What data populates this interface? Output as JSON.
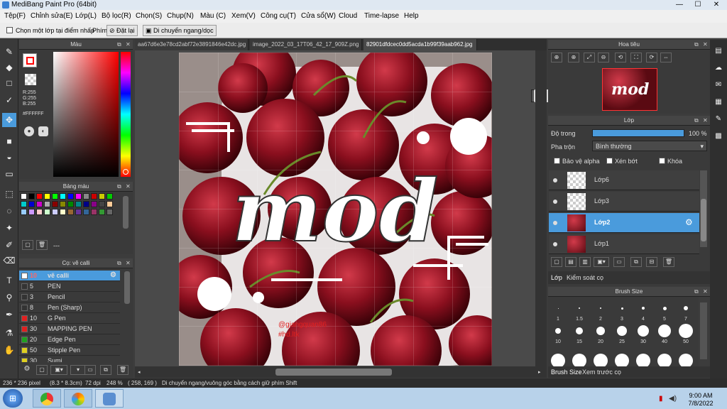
{
  "window": {
    "title": "MediBang Paint Pro (64bit)"
  },
  "menu": [
    "Tệp(F)",
    "Chỉnh sửa(E)",
    "Lớp(L)",
    "Bộ lọc(R)",
    "Chọn(S)",
    "Chụp(N)",
    "Màu (C)",
    "Xem(V)",
    "Công cụ(T)",
    "Cửa sổ(W)",
    "Cloud",
    "Time-lapse",
    "Help"
  ],
  "options": {
    "select_layer": "Chọn một lớp tại điểm nhấp",
    "phim": "Phím",
    "reset": "Đặt lại",
    "move_label": "Di chuyển ngang/dọc"
  },
  "color_panel": {
    "title": "Màu",
    "r": "R:255",
    "g": "G:255",
    "b": "B:255",
    "hex": "#FFFFFF"
  },
  "palette": {
    "title": "Bảng màu",
    "text": "---"
  },
  "brush": {
    "title": "Cọ: vẽ calli",
    "items": [
      {
        "num": "10",
        "label": "vẽ calli",
        "color": "#ffffff",
        "active": true
      },
      {
        "num": "5",
        "label": "PEN",
        "color": "#333333"
      },
      {
        "num": "3",
        "label": "Pencil",
        "color": "#333333"
      },
      {
        "num": "8",
        "label": "Pen (Sharp)",
        "color": "#333333"
      },
      {
        "num": "10",
        "label": "G Pen",
        "color": "#e02020"
      },
      {
        "num": "30",
        "label": "MAPPING PEN",
        "color": "#e02020"
      },
      {
        "num": "20",
        "label": "Edge Pen",
        "color": "#20a020"
      },
      {
        "num": "50",
        "label": "Stipple Pen",
        "color": "#e0d020"
      },
      {
        "num": "30",
        "label": "Sumi",
        "color": "#e0d020"
      }
    ]
  },
  "tabs": [
    "aa67d6e3e78cd2abf72e3891846e42dc.jpg",
    "image_2022_03_17T06_42_17_909Z.png",
    "82901dfdcec0dd5acda1b99f39aab962.jpg"
  ],
  "canvas": {
    "art_text": "mod",
    "credit1": "@giangquan86",
    "credit2": "#hd.ltk"
  },
  "navigator": {
    "title": "Hoa tiêu",
    "thumb_text": "mod"
  },
  "layers": {
    "title": "Lớp",
    "opacity_label": "Độ trong",
    "opacity_value": "100 %",
    "opacity_fraction": 1.0,
    "blend_label": "Pha trộn",
    "blend_value": "Bình thường",
    "protect_alpha": "Bảo vệ alpha",
    "clip": "Xén bớt",
    "lock": "Khóa",
    "items": [
      {
        "name": "Lớp6",
        "selected": false
      },
      {
        "name": "Lớp3",
        "selected": false
      },
      {
        "name": "Lớp2",
        "selected": true
      },
      {
        "name": "Lớp1",
        "selected": false
      }
    ],
    "tab_layer": "Lớp",
    "tab_control": "Kiểm soát cọ"
  },
  "brush_size": {
    "title": "Brush Size",
    "labels": [
      "1",
      "1.5",
      "2",
      "3",
      "4",
      "5",
      "7",
      "10",
      "15",
      "20",
      "25",
      "30",
      "40",
      "50"
    ],
    "tab_size": "Brush Size",
    "tab_preview": "Xem trước cọ"
  },
  "status": {
    "size": "236 * 236 pixel",
    "cm": "(8.3 * 8.3cm)",
    "dpi": "72 dpi",
    "zoom": "248 %",
    "coords": "( 258, 169 )",
    "hint": "Di chuyển ngang/vuông góc bằng cách giữ phím Shift"
  },
  "taskbar": {
    "time": "9:00 AM",
    "date": "7/8/2022"
  },
  "colors": {
    "accent": "#4a9bdc",
    "fg": "#ff0000"
  }
}
